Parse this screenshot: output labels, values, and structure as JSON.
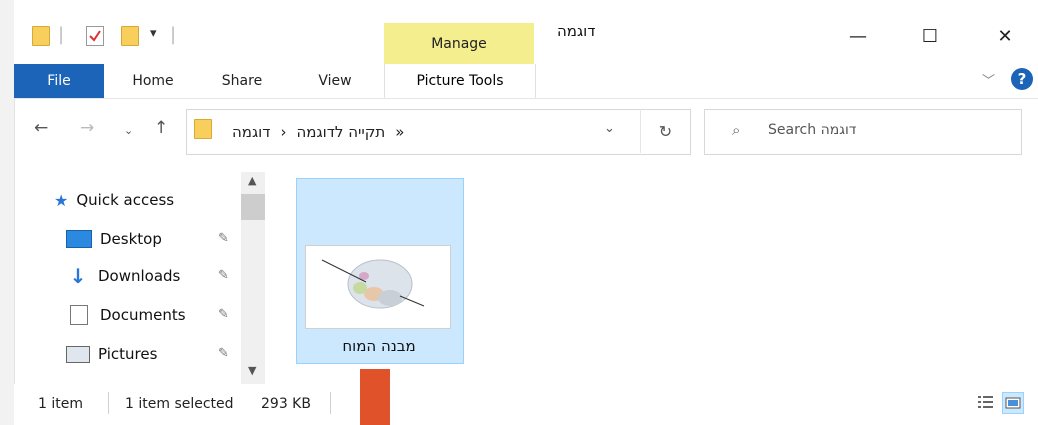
{
  "window": {
    "title": "דוגמה",
    "contextual_group": "Manage",
    "controls": {
      "minimize": "—",
      "maximize": "☐",
      "close": "✕"
    }
  },
  "ribbon": {
    "file": "File",
    "tabs": [
      "Home",
      "Share",
      "View"
    ],
    "contextual_tab": "Picture Tools",
    "help": "?"
  },
  "address": {
    "overflow": "«",
    "path": [
      "תקייה לדוגמה",
      "דוגמה"
    ],
    "separator": "‹"
  },
  "search": {
    "placeholder": "Search דוגמה"
  },
  "nav": {
    "quick_access": "Quick access",
    "items": [
      {
        "label": "Desktop",
        "icon": "desktop-icon"
      },
      {
        "label": "Downloads",
        "icon": "download-icon"
      },
      {
        "label": "Documents",
        "icon": "documents-icon"
      },
      {
        "label": "Pictures",
        "icon": "pictures-icon"
      }
    ]
  },
  "files": [
    {
      "name": "מבנה המוח",
      "selected": true
    }
  ],
  "status": {
    "count": "1 item",
    "selected": "1 item selected",
    "size": "293 KB"
  },
  "colors": {
    "accent": "#1c64b8",
    "manage": "#f4ee8f",
    "selection": "#cce8ff",
    "marker": "#e0522a"
  }
}
